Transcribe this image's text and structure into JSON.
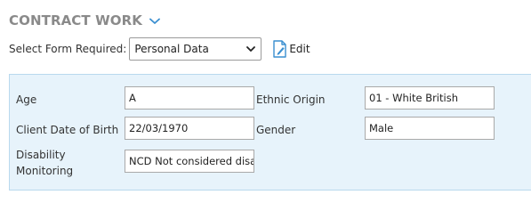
{
  "header": {
    "title": "CONTRACT WORK",
    "toggle_icon": "chevron-down-icon",
    "accent_color": "#3a8fd0"
  },
  "form_selector": {
    "label": "Select Form Required:",
    "selected": "Personal Data",
    "edit_label": "Edit"
  },
  "fields": {
    "age": {
      "label": "Age",
      "value": "A"
    },
    "ethnic_origin": {
      "label": "Ethnic Origin",
      "value": "01 - White British"
    },
    "dob": {
      "label": "Client Date of Birth",
      "value": "22/03/1970"
    },
    "gender": {
      "label": "Gender",
      "value": "Male"
    },
    "disability": {
      "label_line1": "Disability",
      "label_line2": "Monitoring",
      "value": "NCD Not considered disa"
    }
  },
  "colors": {
    "panel_bg": "#e7f3fb",
    "panel_border": "#b9d9ee"
  }
}
